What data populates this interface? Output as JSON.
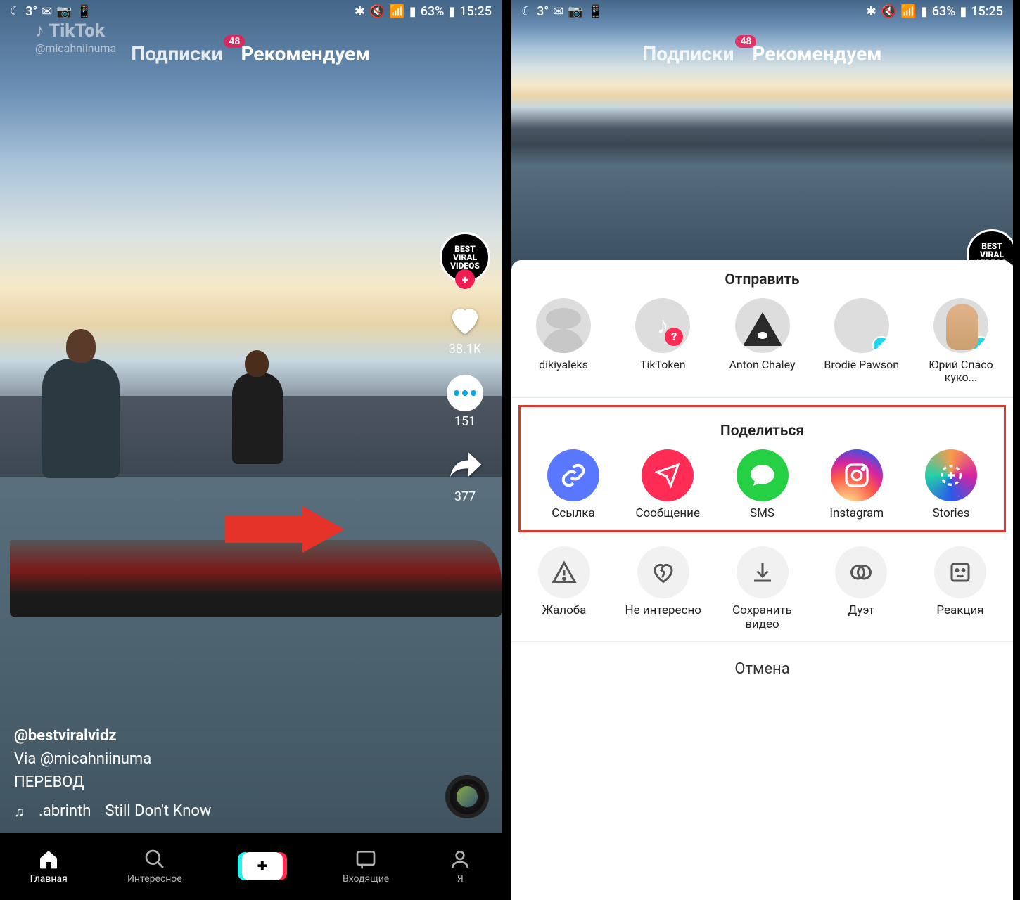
{
  "status": {
    "temp": "3°",
    "battery_pct": "63%",
    "time": "15:25"
  },
  "watermark": {
    "brand": "TikTok",
    "user": "@micahniinuma"
  },
  "tabs": {
    "following": "Подписки",
    "for_you": "Рекомендуем",
    "badge": "48"
  },
  "author_avatar": {
    "text": "BEST\nVIRAL\nVIDEOS"
  },
  "rail": {
    "likes": "38.1K",
    "comments": "151",
    "shares": "377"
  },
  "meta": {
    "username": "@bestviralvidz",
    "caption_line1": "Via @micahniinuma",
    "caption_line2": "ПЕРЕВОД",
    "music_artist": ".abrinth",
    "music_title": "Still Don't Know"
  },
  "bottom_nav": {
    "home": "Главная",
    "discover": "Интересное",
    "inbox": "Входящие",
    "me": "Я"
  },
  "sheet": {
    "send_title": "Отправить",
    "contacts": [
      {
        "name": "dikiyaleks",
        "verified": false
      },
      {
        "name": "TikToken",
        "verified": false
      },
      {
        "name": "Anton Chaley",
        "verified": false
      },
      {
        "name": "Brodie Pawson",
        "verified": true
      },
      {
        "name": "Юрий Спасо\nкуко...",
        "verified": true
      }
    ],
    "share_title": "Поделиться",
    "share_items": [
      {
        "label": "Ссылка"
      },
      {
        "label": "Сообщение"
      },
      {
        "label": "SMS"
      },
      {
        "label": "Instagram"
      },
      {
        "label": "Stories"
      }
    ],
    "actions": [
      {
        "label": "Жалоба"
      },
      {
        "label": "Не интересно"
      },
      {
        "label": "Сохранить видео"
      },
      {
        "label": "Дуэт"
      },
      {
        "label": "Реакция"
      }
    ],
    "cancel": "Отмена"
  }
}
